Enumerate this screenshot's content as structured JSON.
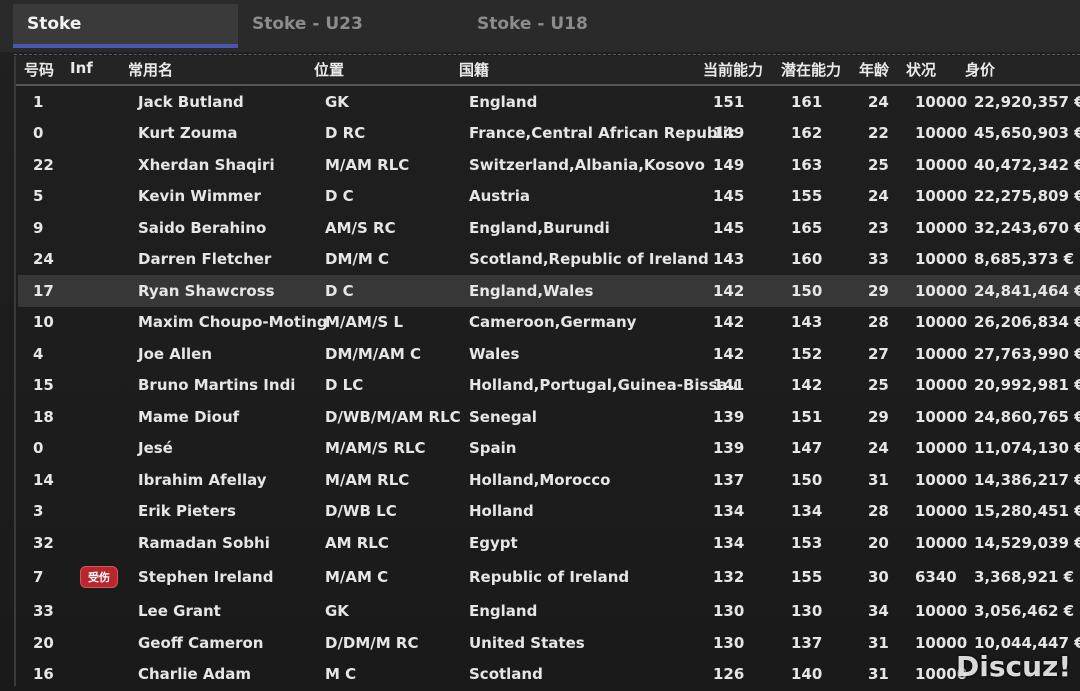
{
  "tabs": [
    {
      "label": "Stoke",
      "active": true
    },
    {
      "label": "Stoke - U23",
      "active": false
    },
    {
      "label": "Stoke - U18",
      "active": false
    }
  ],
  "columns": {
    "number": "号码",
    "inf": "Inf",
    "name": "常用名",
    "position": "位置",
    "nationality": "国籍",
    "current_ability": "当前能力",
    "potential_ability": "潜在能力",
    "age": "年龄",
    "condition": "状况",
    "value": "身价"
  },
  "rows": [
    {
      "number": "1",
      "inf": "",
      "name": "Jack Butland",
      "position": "GK",
      "nationality": "England",
      "ca": "151",
      "pa": "161",
      "age": "24",
      "condition": "10000",
      "value": "22,920,357 €"
    },
    {
      "number": "0",
      "inf": "",
      "name": "Kurt Zouma",
      "position": "D RC",
      "nationality": "France,Central African Republic",
      "ca": "149",
      "pa": "162",
      "age": "22",
      "condition": "10000",
      "value": "45,650,903 €"
    },
    {
      "number": "22",
      "inf": "",
      "name": "Xherdan Shaqiri",
      "position": "M/AM RLC",
      "nationality": "Switzerland,Albania,Kosovo",
      "ca": "149",
      "pa": "163",
      "age": "25",
      "condition": "10000",
      "value": "40,472,342 €"
    },
    {
      "number": "5",
      "inf": "",
      "name": "Kevin Wimmer",
      "position": "D C",
      "nationality": "Austria",
      "ca": "145",
      "pa": "155",
      "age": "24",
      "condition": "10000",
      "value": "22,275,809 €"
    },
    {
      "number": "9",
      "inf": "",
      "name": "Saido Berahino",
      "position": "AM/S RC",
      "nationality": "England,Burundi",
      "ca": "145",
      "pa": "165",
      "age": "23",
      "condition": "10000",
      "value": "32,243,670 €"
    },
    {
      "number": "24",
      "inf": "",
      "name": "Darren Fletcher",
      "position": "DM/M C",
      "nationality": "Scotland,Republic of Ireland",
      "ca": "143",
      "pa": "160",
      "age": "33",
      "condition": "10000",
      "value": "8,685,373 €"
    },
    {
      "number": "17",
      "inf": "",
      "name": "Ryan Shawcross",
      "position": "D C",
      "nationality": "England,Wales",
      "ca": "142",
      "pa": "150",
      "age": "29",
      "condition": "10000",
      "value": "24,841,464 €",
      "selected": true
    },
    {
      "number": "10",
      "inf": "",
      "name": "Maxim Choupo-Moting",
      "position": "M/AM/S L",
      "nationality": "Cameroon,Germany",
      "ca": "142",
      "pa": "143",
      "age": "28",
      "condition": "10000",
      "value": "26,206,834 €"
    },
    {
      "number": "4",
      "inf": "",
      "name": "Joe Allen",
      "position": "DM/M/AM C",
      "nationality": "Wales",
      "ca": "142",
      "pa": "152",
      "age": "27",
      "condition": "10000",
      "value": "27,763,990 €"
    },
    {
      "number": "15",
      "inf": "",
      "name": "Bruno Martins Indi",
      "position": "D LC",
      "nationality": "Holland,Portugal,Guinea-Bissau",
      "ca": "141",
      "pa": "142",
      "age": "25",
      "condition": "10000",
      "value": "20,992,981 €"
    },
    {
      "number": "18",
      "inf": "",
      "name": "Mame Diouf",
      "position": "D/WB/M/AM RLC",
      "nationality": "Senegal",
      "ca": "139",
      "pa": "151",
      "age": "29",
      "condition": "10000",
      "value": "24,860,765 €"
    },
    {
      "number": "0",
      "inf": "",
      "name": "Jesé",
      "position": "M/AM/S RLC",
      "nationality": "Spain",
      "ca": "139",
      "pa": "147",
      "age": "24",
      "condition": "10000",
      "value": "11,074,130 €"
    },
    {
      "number": "14",
      "inf": "",
      "name": "Ibrahim Afellay",
      "position": "M/AM RLC",
      "nationality": "Holland,Morocco",
      "ca": "137",
      "pa": "150",
      "age": "31",
      "condition": "10000",
      "value": "14,386,217 €"
    },
    {
      "number": "3",
      "inf": "",
      "name": "Erik Pieters",
      "position": "D/WB LC",
      "nationality": "Holland",
      "ca": "134",
      "pa": "134",
      "age": "28",
      "condition": "10000",
      "value": "15,280,451 €"
    },
    {
      "number": "32",
      "inf": "",
      "name": "Ramadan Sobhi",
      "position": "AM RLC",
      "nationality": "Egypt",
      "ca": "134",
      "pa": "153",
      "age": "20",
      "condition": "10000",
      "value": "14,529,039 €"
    },
    {
      "number": "7",
      "inf": "受伤",
      "name": "Stephen Ireland",
      "position": "M/AM C",
      "nationality": "Republic of Ireland",
      "ca": "132",
      "pa": "155",
      "age": "30",
      "condition": "6340",
      "value": "3,368,921 €"
    },
    {
      "number": "33",
      "inf": "",
      "name": "Lee Grant",
      "position": "GK",
      "nationality": "England",
      "ca": "130",
      "pa": "130",
      "age": "34",
      "condition": "10000",
      "value": "3,056,462 €"
    },
    {
      "number": "20",
      "inf": "",
      "name": "Geoff Cameron",
      "position": "D/DM/M RC",
      "nationality": "United States",
      "ca": "130",
      "pa": "137",
      "age": "31",
      "condition": "10000",
      "value": "10,044,447 €"
    },
    {
      "number": "16",
      "inf": "",
      "name": "Charlie Adam",
      "position": "M C",
      "nationality": "Scotland",
      "ca": "126",
      "pa": "140",
      "age": "31",
      "condition": "10000",
      "value": ""
    }
  ],
  "watermark": "Discuz!"
}
